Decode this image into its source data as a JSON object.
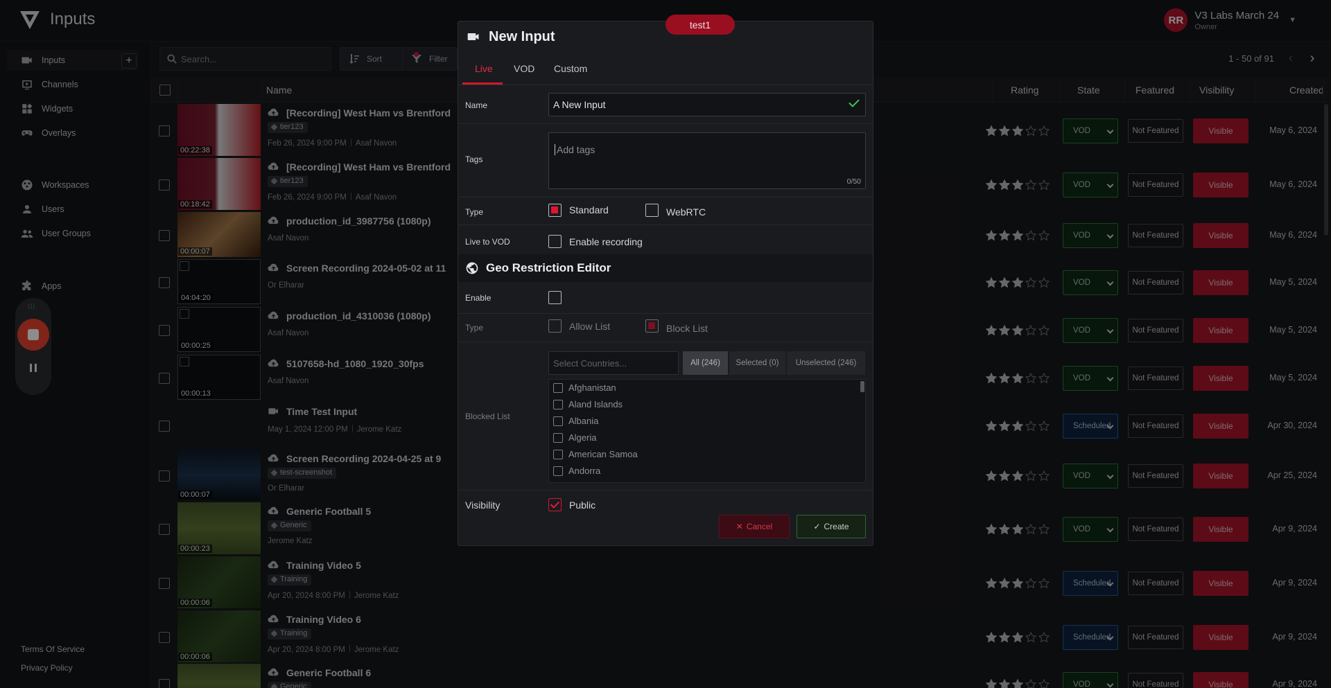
{
  "app": {
    "page_title": "Inputs",
    "tenant": "test1",
    "account": {
      "initials": "RR",
      "name": "V3 Labs March 24",
      "role": "Owner"
    }
  },
  "sidebar": {
    "items": [
      {
        "label": "Inputs",
        "icon": "camera-icon"
      },
      {
        "label": "Channels",
        "icon": "play-screen-icon"
      },
      {
        "label": "Widgets",
        "icon": "widgets-icon"
      },
      {
        "label": "Overlays",
        "icon": "gamepad-icon"
      },
      {
        "label": "Workspaces",
        "icon": "workspaces-icon"
      },
      {
        "label": "Users",
        "icon": "user-icon"
      },
      {
        "label": "User Groups",
        "icon": "users-icon"
      },
      {
        "label": "Apps",
        "icon": "puzzle-icon"
      }
    ],
    "footer": {
      "terms": "Terms Of Service",
      "privacy": "Privacy Policy"
    }
  },
  "toolbar": {
    "search_placeholder": "Search...",
    "sort_label": "Sort",
    "filter_label": "Filter",
    "pager": "1 - 50 of 91"
  },
  "table": {
    "columns": {
      "name": "Name",
      "rating": "Rating",
      "state": "State",
      "featured": "Featured",
      "visibility": "Visibility",
      "created": "Created"
    },
    "rows": [
      {
        "title": "[Recording] West Ham vs Brentford",
        "icon": "cloud-upload-icon",
        "tag": "tier123",
        "meta": [
          "Feb 26, 2024 9:00 PM",
          "Asaf Navon"
        ],
        "duration": "00:22:38",
        "rating": 3,
        "state": "VOD",
        "featured": "Not Featured",
        "visibility": "Visible",
        "created": "May 6, 2024"
      },
      {
        "title": "[Recording] West Ham vs Brentford",
        "icon": "cloud-upload-icon",
        "tag": "tier123",
        "meta": [
          "Feb 26, 2024 9:00 PM",
          "Asaf Navon"
        ],
        "duration": "00:18:42",
        "rating": 3,
        "state": "VOD",
        "featured": "Not Featured",
        "visibility": "Visible",
        "created": "May 6, 2024"
      },
      {
        "title": "production_id_3987756 (1080p)",
        "icon": "cloud-upload-icon",
        "tag": "",
        "meta": [
          "Asaf Navon"
        ],
        "duration": "00:00:07",
        "rating": 3,
        "state": "VOD",
        "featured": "Not Featured",
        "visibility": "Visible",
        "created": "May 6, 2024"
      },
      {
        "title": "Screen Recording 2024-05-02 at 11",
        "icon": "cloud-upload-icon",
        "tag": "",
        "meta": [
          "Or Elharar"
        ],
        "duration": "04:04:20",
        "rating": 3,
        "state": "VOD",
        "featured": "Not Featured",
        "visibility": "Visible",
        "created": "May 5, 2024"
      },
      {
        "title": "production_id_4310036 (1080p)",
        "icon": "cloud-upload-icon",
        "tag": "",
        "meta": [
          "Asaf Navon"
        ],
        "duration": "00:00:25",
        "rating": 3,
        "state": "VOD",
        "featured": "Not Featured",
        "visibility": "Visible",
        "created": "May 5, 2024"
      },
      {
        "title": "5107658-hd_1080_1920_30fps",
        "icon": "cloud-upload-icon",
        "tag": "",
        "meta": [
          "Asaf Navon"
        ],
        "duration": "00:00:13",
        "rating": 3,
        "state": "VOD",
        "featured": "Not Featured",
        "visibility": "Visible",
        "created": "May 5, 2024"
      },
      {
        "title": "Time Test Input",
        "icon": "camera-icon",
        "tag": "",
        "meta": [
          "May 1, 2024 12:00 PM",
          "Jerome Katz"
        ],
        "duration": "",
        "rating": 3,
        "state": "Scheduled",
        "featured": "Not Featured",
        "visibility": "Visible",
        "created": "Apr 30, 2024"
      },
      {
        "title": "Screen Recording 2024-04-25 at 9",
        "icon": "cloud-upload-icon",
        "tag": "test-screenshot",
        "meta": [
          "Or Elharar"
        ],
        "duration": "00:00:07",
        "rating": 3,
        "state": "VOD",
        "featured": "Not Featured",
        "visibility": "Visible",
        "created": "Apr 25, 2024"
      },
      {
        "title": "Generic Football 5",
        "icon": "cloud-upload-icon",
        "tag": "Generic",
        "meta": [
          "Jerome Katz"
        ],
        "duration": "00:00:23",
        "rating": 3,
        "state": "VOD",
        "featured": "Not Featured",
        "visibility": "Visible",
        "created": "Apr 9, 2024"
      },
      {
        "title": "Training Video 5",
        "icon": "cloud-upload-icon",
        "tag": "Training",
        "meta": [
          "Apr 20, 2024 8:00 PM",
          "Jerome Katz"
        ],
        "duration": "00:00:06",
        "rating": 3,
        "state": "Scheduled",
        "featured": "Not Featured",
        "visibility": "Visible",
        "created": "Apr 9, 2024"
      },
      {
        "title": "Training Video 6",
        "icon": "cloud-upload-icon",
        "tag": "Training",
        "meta": [
          "Apr 20, 2024 8:00 PM",
          "Jerome Katz"
        ],
        "duration": "00:00:06",
        "rating": 3,
        "state": "Scheduled",
        "featured": "Not Featured",
        "visibility": "Visible",
        "created": "Apr 9, 2024"
      },
      {
        "title": "Generic Football 6",
        "icon": "cloud-upload-icon",
        "tag": "Generic",
        "meta": [],
        "duration": "",
        "rating": 3,
        "state": "VOD",
        "featured": "Not Featured",
        "visibility": "Visible",
        "created": "Apr 9, 2024"
      }
    ]
  },
  "modal": {
    "title": "New Input",
    "tabs": [
      "Live",
      "VOD",
      "Custom"
    ],
    "active_tab": "Live",
    "fields": {
      "name_label": "Name",
      "name_value": "A New Input",
      "tags_label": "Tags",
      "tags_placeholder": "Add tags",
      "tags_count": "0/50",
      "type_label": "Type",
      "type_standard": "Standard",
      "type_webrtc": "WebRTC",
      "live_to_vod_label": "Live to VOD",
      "enable_recording": "Enable recording"
    },
    "geo": {
      "title": "Geo Restriction Editor",
      "enable_label": "Enable",
      "type_label": "Type",
      "allow_list": "Allow List",
      "block_list": "Block List",
      "countries_placeholder": "Select Countries...",
      "segments": [
        "All (246)",
        "Selected (0)",
        "Unselected (246)"
      ],
      "blocked_list_label": "Blocked List",
      "countries": [
        "Afghanistan",
        "Aland Islands",
        "Albania",
        "Algeria",
        "American Samoa",
        "Andorra"
      ]
    },
    "visibility_label": "Visibility",
    "public_label": "Public",
    "cancel_label": "Cancel",
    "create_label": "Create"
  },
  "colors": {
    "accent": "#d0182f",
    "success": "#3ec35a",
    "vod_border": "#2e7a3b",
    "scheduled_border": "#2f5c92"
  }
}
